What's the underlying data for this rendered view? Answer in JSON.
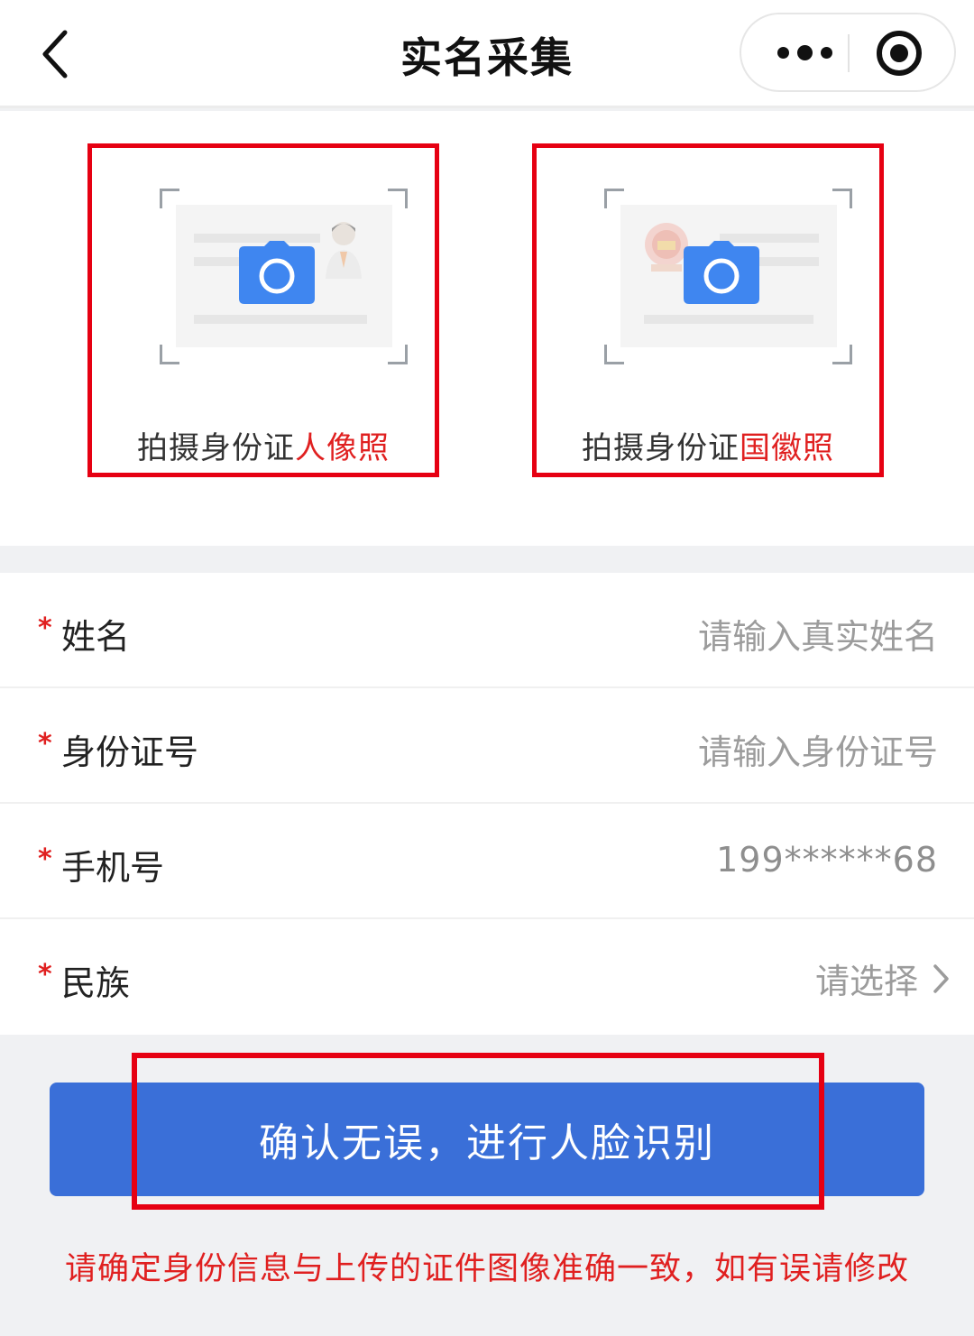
{
  "nav": {
    "title": "实名采集",
    "back_icon": "chevron-left-icon",
    "more_icon": "more-dots-icon",
    "close_icon": "target-circle-icon"
  },
  "upload": {
    "portrait": {
      "prefix": "拍摄身份证",
      "highlight": "人像照",
      "icon": "camera-icon"
    },
    "emblem": {
      "prefix": "拍摄身份证",
      "highlight": "国徽照",
      "icon": "camera-icon"
    }
  },
  "form": {
    "required_mark": "*",
    "name": {
      "label": "姓名",
      "placeholder": "请输入真实姓名"
    },
    "id_number": {
      "label": "身份证号",
      "placeholder": "请输入身份证号"
    },
    "phone": {
      "label": "手机号",
      "value": "199******68"
    },
    "ethnicity": {
      "label": "民族",
      "placeholder": "请选择",
      "icon": "chevron-right-icon"
    }
  },
  "confirm_button": "确认无误，进行人脸识别",
  "notice": "请确定身份信息与上传的证件图像准确一致，如有误请修改",
  "colors": {
    "accent_blue": "#3a6fd8",
    "camera_blue": "#3f86f0",
    "warning_red": "#e02020",
    "highlight_frame": "#e60012"
  }
}
